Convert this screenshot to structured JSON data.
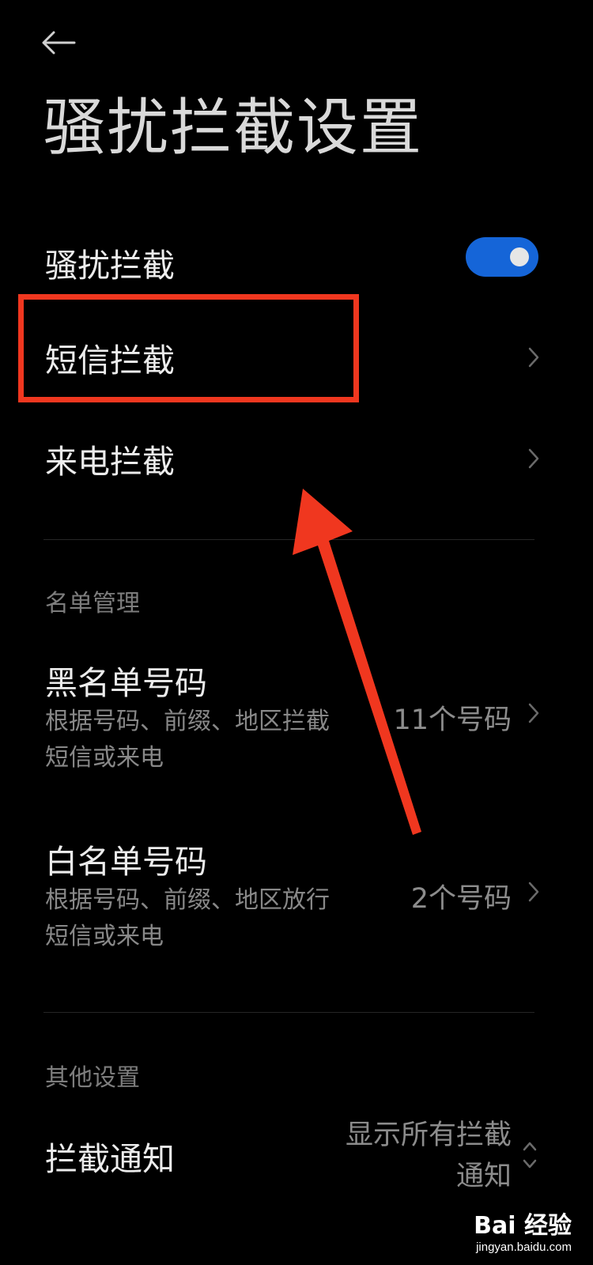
{
  "header": {
    "back_icon": "arrow-left-icon",
    "title": "骚扰拦截设置"
  },
  "main_toggle": {
    "label": "骚扰拦截",
    "on": true,
    "color": "#1565d8"
  },
  "items": {
    "sms": {
      "label": "短信拦截",
      "icon": "chevron-right-icon"
    },
    "call": {
      "label": "来电拦截",
      "icon": "chevron-right-icon"
    }
  },
  "list_management": {
    "header": "名单管理",
    "blacklist": {
      "title": "黑名单号码",
      "desc_line1": "根据号码、前缀、地区拦截",
      "desc_line2": "短信或来电",
      "value": "11个号码"
    },
    "whitelist": {
      "title": "白名单号码",
      "desc_line1": "根据号码、前缀、地区放行",
      "desc_line2": "短信或来电",
      "value": "2个号码"
    }
  },
  "other_settings": {
    "header": "其他设置",
    "notification": {
      "label": "拦截通知",
      "value_line1": "显示所有拦截",
      "value_line2": "通知"
    }
  },
  "annotation": {
    "highlight_color": "#f0371f"
  },
  "watermark": {
    "logo": "Bai 经验",
    "url": "jingyan.baidu.com"
  }
}
